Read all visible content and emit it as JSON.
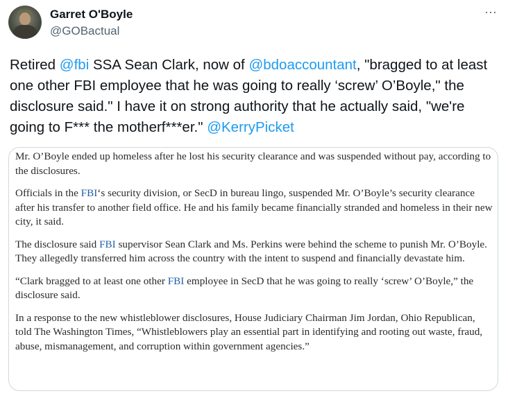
{
  "author": {
    "name": "Garret O'Boyle",
    "handle": "@GOBactual"
  },
  "menu": {
    "more_label": "···"
  },
  "tweet": {
    "t1": "Retired ",
    "m1": "@fbi",
    "t2": " SSA Sean Clark, now of ",
    "m2": "@bdoaccountant",
    "t3": ", \"bragged to at least one other FBI employee that he was going to really ‘screw’ O’Boyle,\" the disclosure said.\" I have it on strong authority that he actually said, \"we're going to F*** the motherf***er.\" ",
    "m3": "@KerryPicket"
  },
  "article": {
    "p1": "Mr. O’Boyle ended up homeless after he lost his security clearance and was suspended without pay, according to the disclosures.",
    "p2a": "Officials in the ",
    "fbi": "FBI",
    "p2b": "‘s security division, or SecD in bureau lingo, suspended Mr. O’Boyle’s security clearance after his transfer to another field office. He and his family became financially stranded and homeless in their new city, it said.",
    "p3a": "The disclosure said ",
    "p3b": " supervisor Sean Clark and Ms. Perkins were behind the scheme to punish Mr. O’Boyle. They allegedly transferred him across the country with the intent to suspend and financially devastate him.",
    "p4a": "“Clark bragged to at least one other ",
    "p4b": " employee in SecD that he was going to really ‘screw’ O’Boyle,” the disclosure said.",
    "p5": "In a response to the new whistleblower disclosures, House Judiciary Chairman Jim Jordan, Ohio Republican, told The Washington Times, “Whistleblowers play an essential part in identifying and rooting out waste, fraud, abuse, mismanagement, and corruption within government agencies.”"
  },
  "colors": {
    "link": "#1d9bf0",
    "article_link": "#1f5fa8",
    "secondary_text": "#536471",
    "border": "#cfd9de"
  }
}
